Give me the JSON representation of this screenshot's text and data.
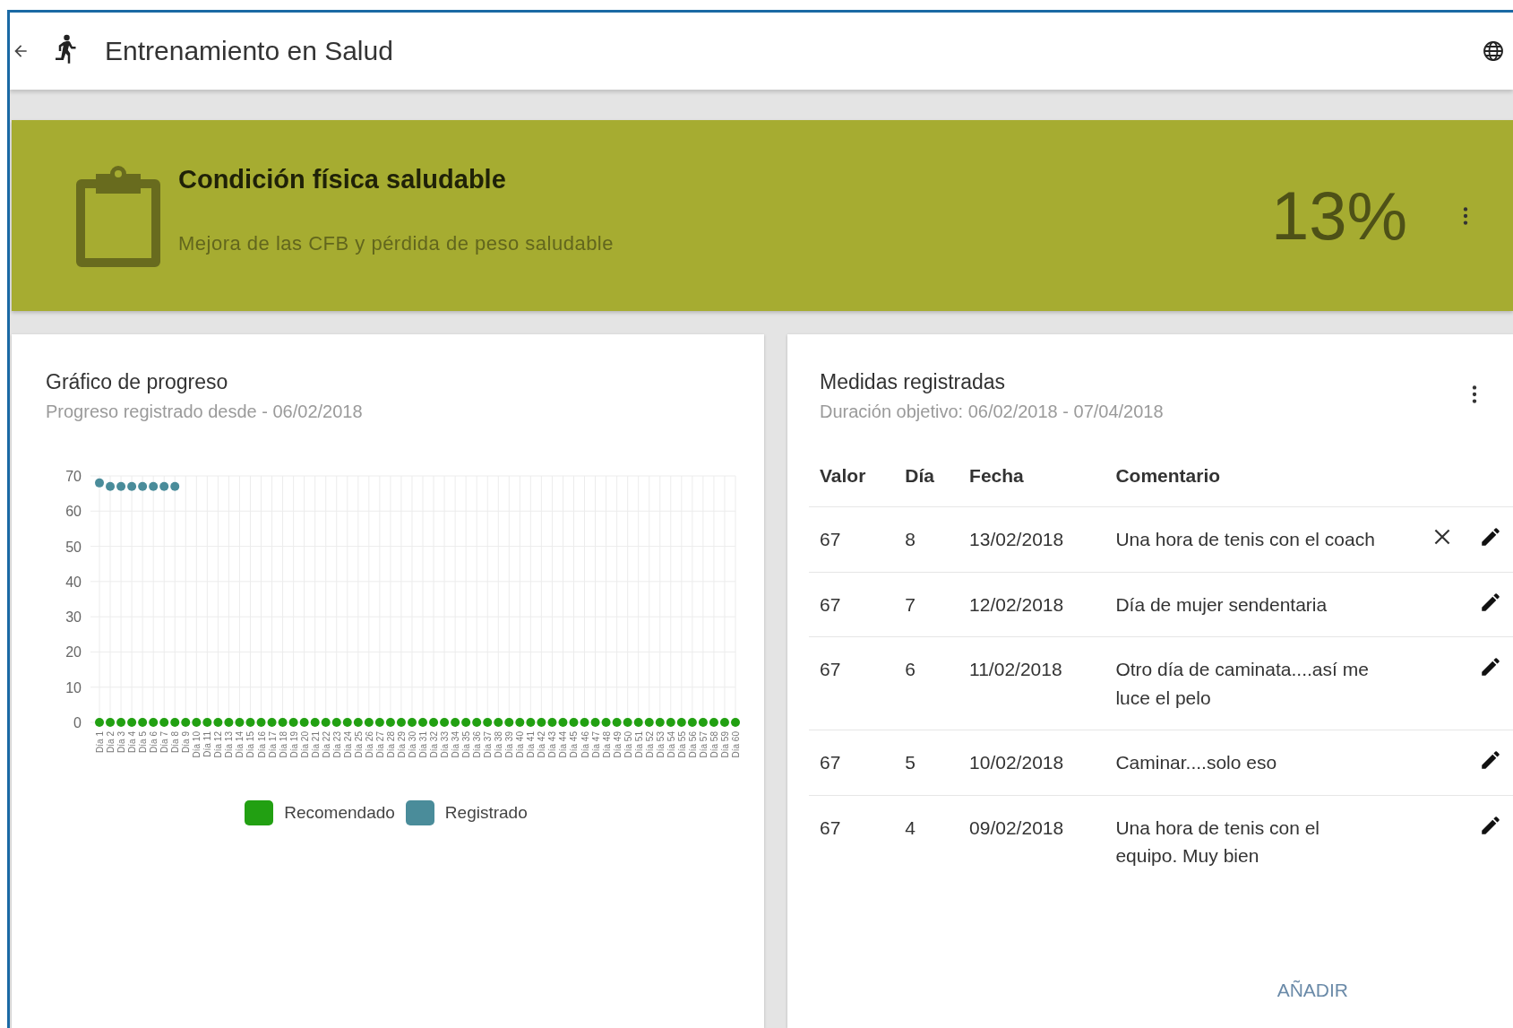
{
  "app_bar": {
    "title": "Entrenamiento en Salud"
  },
  "goal": {
    "title": "Condición física saludable",
    "subtitle": "Mejora de las CFB y pérdida de peso saludable",
    "percent": "13%"
  },
  "progress_card": {
    "title": "Gráfico de progreso",
    "subtitle": "Progreso registrado desde - 06/02/2018",
    "chart_data": {
      "type": "scatter",
      "categories": [
        "Día 1",
        "Día 2",
        "Día 3",
        "Día 4",
        "Día 5",
        "Día 6",
        "Día 7",
        "Día 8",
        "Día 9",
        "Día 10",
        "Día 11",
        "Día 12",
        "Día 13",
        "Día 14",
        "Día 15",
        "Día 16",
        "Día 17",
        "Día 18",
        "Día 19",
        "Día 20",
        "Día 21",
        "Día 22",
        "Día 23",
        "Día 24",
        "Día 25",
        "Día 26",
        "Día 27",
        "Día 28",
        "Día 29",
        "Día 30",
        "Día 31",
        "Día 32",
        "Día 33",
        "Día 34",
        "Día 35",
        "Día 36",
        "Día 37",
        "Día 38",
        "Día 39",
        "Día 40",
        "Día 41",
        "Día 42",
        "Día 43",
        "Día 44",
        "Día 45",
        "Día 46",
        "Día 47",
        "Día 48",
        "Día 49",
        "Día 50",
        "Día 51",
        "Día 52",
        "Día 53",
        "Día 54",
        "Día 55",
        "Día 56",
        "Día 57",
        "Día 58",
        "Día 59",
        "Día 60"
      ],
      "grid": true,
      "ylim": [
        0,
        70
      ],
      "yticks": [
        0,
        10,
        20,
        30,
        40,
        50,
        60,
        70
      ],
      "series": [
        {
          "name": "Recomendado",
          "color": "#22a012",
          "values": [
            0,
            0,
            0,
            0,
            0,
            0,
            0,
            0,
            0,
            0,
            0,
            0,
            0,
            0,
            0,
            0,
            0,
            0,
            0,
            0,
            0,
            0,
            0,
            0,
            0,
            0,
            0,
            0,
            0,
            0,
            0,
            0,
            0,
            0,
            0,
            0,
            0,
            0,
            0,
            0,
            0,
            0,
            0,
            0,
            0,
            0,
            0,
            0,
            0,
            0,
            0,
            0,
            0,
            0,
            0,
            0,
            0,
            0,
            0,
            0
          ]
        },
        {
          "name": "Registrado",
          "color": "#4a8c9a",
          "values": [
            68,
            67,
            67,
            67,
            67,
            67,
            67,
            67,
            null,
            null,
            null,
            null,
            null,
            null,
            null,
            null,
            null,
            null,
            null,
            null,
            null,
            null,
            null,
            null,
            null,
            null,
            null,
            null,
            null,
            null,
            null,
            null,
            null,
            null,
            null,
            null,
            null,
            null,
            null,
            null,
            null,
            null,
            null,
            null,
            null,
            null,
            null,
            null,
            null,
            null,
            null,
            null,
            null,
            null,
            null,
            null,
            null,
            null,
            null,
            null
          ]
        }
      ]
    }
  },
  "measures_card": {
    "title": "Medidas registradas",
    "subtitle": "Duración objetivo: 06/02/2018 - 07/04/2018",
    "columns": [
      "Valor",
      "Día",
      "Fecha",
      "Comentario"
    ],
    "rows": [
      {
        "value": "67",
        "day": "8",
        "date": "13/02/2018",
        "comment": "Una hora de tenis con el coach",
        "deletable": true
      },
      {
        "value": "67",
        "day": "7",
        "date": "12/02/2018",
        "comment": "Día de mujer sendentaria",
        "deletable": false
      },
      {
        "value": "67",
        "day": "6",
        "date": "11/02/2018",
        "comment": "Otro día de caminata....así me luce el pelo",
        "deletable": false
      },
      {
        "value": "67",
        "day": "5",
        "date": "10/02/2018",
        "comment": "Caminar....solo eso",
        "deletable": false
      },
      {
        "value": "67",
        "day": "4",
        "date": "09/02/2018",
        "comment": "Una hora de tenis con el equipo. Muy bien",
        "deletable": false
      }
    ],
    "add_button": "AÑADIR"
  }
}
